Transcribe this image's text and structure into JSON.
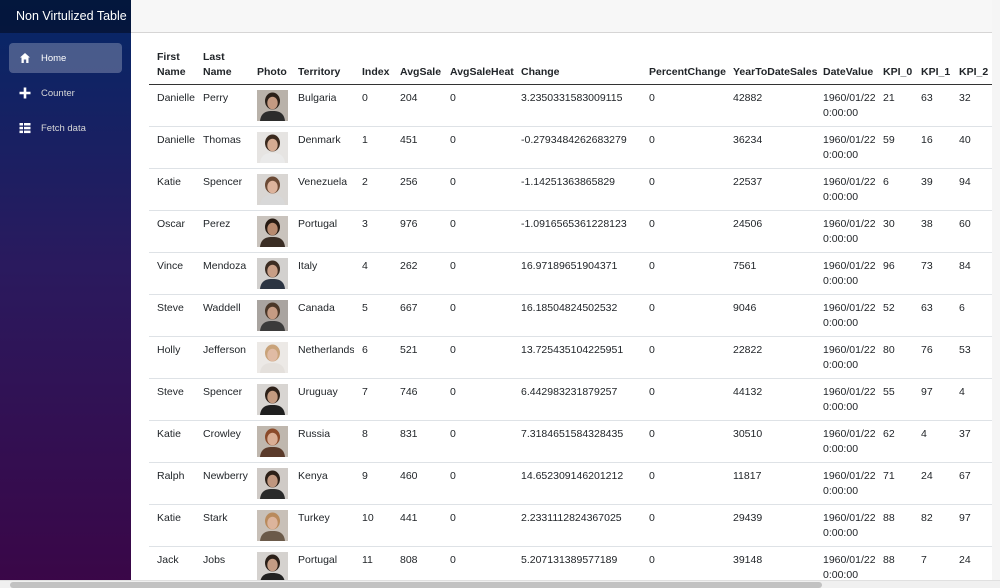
{
  "app": {
    "title": "Non Virtulized Table"
  },
  "nav": [
    {
      "label": "Home",
      "icon": "home-icon",
      "active": true
    },
    {
      "label": "Counter",
      "icon": "plus-icon",
      "active": false
    },
    {
      "label": "Fetch data",
      "icon": "list-icon",
      "active": false
    }
  ],
  "table": {
    "headers": [
      "First Name",
      "Last Name",
      "Photo",
      "Territory",
      "Index",
      "AvgSale",
      "AvgSaleHeat",
      "Change",
      "PercentChange",
      "YearToDateSales",
      "DateValue",
      "KPI_0",
      "KPI_1",
      "KPI_2"
    ],
    "rows": [
      {
        "first": "Danielle",
        "last": "Perry",
        "territory": "Bulgaria",
        "index": "0",
        "avgSale": "204",
        "avgSaleHeat": "0",
        "change": "3.2350331583009115",
        "percentChange": "0",
        "ytd": "42882",
        "date": "1960/01/22 0:00:00",
        "kpi0": "21",
        "kpi1": "63",
        "kpi2": "32",
        "photo": {
          "bg": "#b9b2aa",
          "hair": "#2a2019",
          "skin": "#c49a82",
          "shirt": "#2c2c2c"
        }
      },
      {
        "first": "Danielle",
        "last": "Thomas",
        "territory": "Denmark",
        "index": "1",
        "avgSale": "451",
        "avgSaleHeat": "0",
        "change": "-0.2793484262683279",
        "percentChange": "0",
        "ytd": "36234",
        "date": "1960/01/22 0:00:00",
        "kpi0": "59",
        "kpi1": "16",
        "kpi2": "40",
        "photo": {
          "bg": "#e6e4e2",
          "hair": "#3b2a1e",
          "skin": "#d4ab92",
          "shirt": "#eaeaea"
        }
      },
      {
        "first": "Katie",
        "last": "Spencer",
        "territory": "Venezuela",
        "index": "2",
        "avgSale": "256",
        "avgSaleHeat": "0",
        "change": "-1.14251363865829",
        "percentChange": "0",
        "ytd": "22537",
        "date": "1960/01/22 0:00:00",
        "kpi0": "6",
        "kpi1": "39",
        "kpi2": "94",
        "photo": {
          "bg": "#d9d6d3",
          "hair": "#6b4a35",
          "skin": "#dcb39c",
          "shirt": "#d8d8d8"
        }
      },
      {
        "first": "Oscar",
        "last": "Perez",
        "territory": "Portugal",
        "index": "3",
        "avgSale": "976",
        "avgSaleHeat": "0",
        "change": "-1.0916565361228123",
        "percentChange": "0",
        "ytd": "24506",
        "date": "1960/01/22 0:00:00",
        "kpi0": "30",
        "kpi1": "38",
        "kpi2": "60",
        "photo": {
          "bg": "#c9c3bd",
          "hair": "#261a12",
          "skin": "#b78a6f",
          "shirt": "#3a2d24"
        }
      },
      {
        "first": "Vince",
        "last": "Mendoza",
        "territory": "Italy",
        "index": "4",
        "avgSale": "262",
        "avgSaleHeat": "0",
        "change": "16.97189651904371",
        "percentChange": "0",
        "ytd": "7561",
        "date": "1960/01/22 0:00:00",
        "kpi0": "96",
        "kpi1": "73",
        "kpi2": "84",
        "photo": {
          "bg": "#d2d0ce",
          "hair": "#3b2c22",
          "skin": "#c89e86",
          "shirt": "#2b3442"
        }
      },
      {
        "first": "Steve",
        "last": "Waddell",
        "territory": "Canada",
        "index": "5",
        "avgSale": "667",
        "avgSaleHeat": "0",
        "change": "16.18504824502532",
        "percentChange": "0",
        "ytd": "9046",
        "date": "1960/01/22 0:00:00",
        "kpi0": "52",
        "kpi1": "63",
        "kpi2": "6",
        "photo": {
          "bg": "#a9a4a0",
          "hair": "#4a3728",
          "skin": "#c59b83",
          "shirt": "#3b3b3b"
        }
      },
      {
        "first": "Holly",
        "last": "Jefferson",
        "territory": "Netherlands",
        "index": "6",
        "avgSale": "521",
        "avgSaleHeat": "0",
        "change": "13.725435104225951",
        "percentChange": "0",
        "ytd": "22822",
        "date": "1960/01/22 0:00:00",
        "kpi0": "80",
        "kpi1": "76",
        "kpi2": "53",
        "photo": {
          "bg": "#ece9e6",
          "hair": "#c9a37a",
          "skin": "#e0bba4",
          "shirt": "#e4e0dc"
        }
      },
      {
        "first": "Steve",
        "last": "Spencer",
        "territory": "Uruguay",
        "index": "7",
        "avgSale": "746",
        "avgSaleHeat": "0",
        "change": "6.442983231879257",
        "percentChange": "0",
        "ytd": "44132",
        "date": "1960/01/22 0:00:00",
        "kpi0": "55",
        "kpi1": "97",
        "kpi2": "4",
        "photo": {
          "bg": "#d8d5d2",
          "hair": "#2e2119",
          "skin": "#c39a80",
          "shirt": "#1f1f1f"
        }
      },
      {
        "first": "Katie",
        "last": "Crowley",
        "territory": "Russia",
        "index": "8",
        "avgSale": "831",
        "avgSaleHeat": "0",
        "change": "7.3184651584328435",
        "percentChange": "0",
        "ytd": "30510",
        "date": "1960/01/22 0:00:00",
        "kpi0": "62",
        "kpi1": "4",
        "kpi2": "37",
        "photo": {
          "bg": "#bfb7ae",
          "hair": "#8a4a2a",
          "skin": "#d9ae95",
          "shirt": "#5a3a2a"
        }
      },
      {
        "first": "Ralph",
        "last": "Newberry",
        "territory": "Kenya",
        "index": "9",
        "avgSale": "460",
        "avgSaleHeat": "0",
        "change": "14.652309146201212",
        "percentChange": "0",
        "ytd": "11817",
        "date": "1960/01/22 0:00:00",
        "kpi0": "71",
        "kpi1": "24",
        "kpi2": "67",
        "photo": {
          "bg": "#cfcac6",
          "hair": "#2c2018",
          "skin": "#c0967e",
          "shirt": "#2a2a2a"
        }
      },
      {
        "first": "Katie",
        "last": "Stark",
        "territory": "Turkey",
        "index": "10",
        "avgSale": "441",
        "avgSaleHeat": "0",
        "change": "2.2331112824367025",
        "percentChange": "0",
        "ytd": "29439",
        "date": "1960/01/22 0:00:00",
        "kpi0": "88",
        "kpi1": "82",
        "kpi2": "97",
        "photo": {
          "bg": "#c8c0b8",
          "hair": "#b98a5c",
          "skin": "#dcb49c",
          "shirt": "#6b5a4a"
        }
      },
      {
        "first": "Jack",
        "last": "Jobs",
        "territory": "Portugal",
        "index": "11",
        "avgSale": "808",
        "avgSaleHeat": "0",
        "change": "5.207131389577189",
        "percentChange": "0",
        "ytd": "39148",
        "date": "1960/01/22 0:00:00",
        "kpi0": "88",
        "kpi1": "7",
        "kpi2": "24",
        "photo": {
          "bg": "#d5d2cf",
          "hair": "#2a1f18",
          "skin": "#c49c84",
          "shirt": "#222222"
        }
      }
    ]
  }
}
